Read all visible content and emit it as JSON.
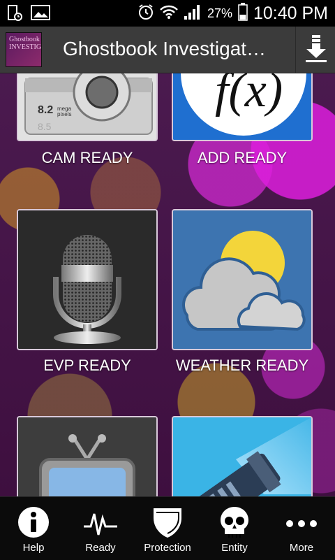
{
  "status_bar": {
    "battery": "27%",
    "time": "10:40 PM"
  },
  "action_bar": {
    "title": "Ghostbook Investigat…",
    "logo_text": "Ghostbook INVESTIGATOR"
  },
  "tiles": [
    {
      "label": "CAM READY",
      "icon": "camera-icon",
      "badge": "8.2 mega pixels"
    },
    {
      "label": "ADD READY",
      "icon": "formula-icon",
      "formula": "f(x)"
    },
    {
      "label": "EVP READY",
      "icon": "microphone-icon"
    },
    {
      "label": "WEATHER READY",
      "icon": "weather-icon"
    },
    {
      "label": "",
      "icon": "tv-icon"
    },
    {
      "label": "",
      "icon": "flashlight-icon"
    }
  ],
  "bottom_nav": [
    {
      "label": "Help",
      "icon": "info-icon"
    },
    {
      "label": "Ready",
      "icon": "pulse-icon"
    },
    {
      "label": "Protection",
      "icon": "shield-icon"
    },
    {
      "label": "Entity",
      "icon": "skull-icon"
    },
    {
      "label": "More",
      "icon": "more-icon"
    }
  ],
  "colors": {
    "background": "#3e0f3f",
    "action_bar": "#3b3b3b",
    "bottom_nav": "#0b0b0b",
    "tile_blue": "#3d74b0",
    "formula_bg": "#1f6fd0"
  }
}
